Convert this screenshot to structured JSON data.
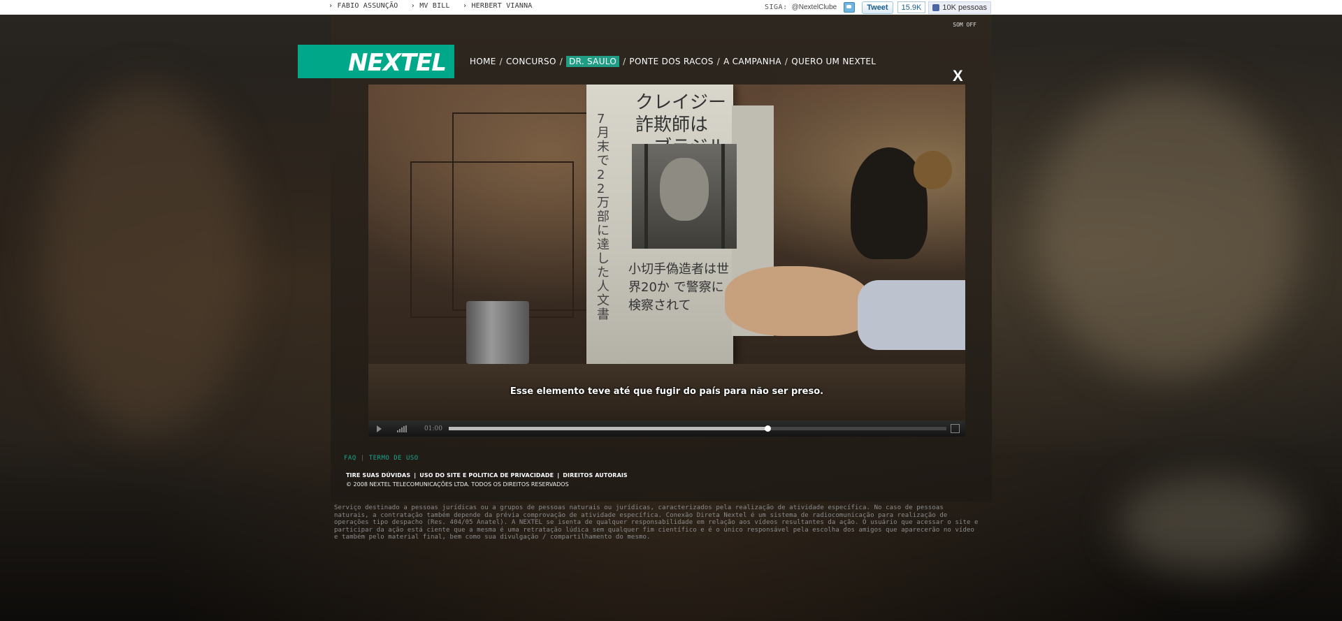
{
  "top_links": [
    "› FABIO ASSUNÇÃO",
    "› MV BILL",
    "› HERBERT VIANNA"
  ],
  "social": {
    "siga_label": "SIGA:",
    "twitter_handle": "@NextelClube",
    "tweet_label": "Tweet",
    "tweet_count": "15.9K",
    "like_label": "10K pessoas"
  },
  "sound_toggle": "SOM OFF",
  "logo_text": "NEXTEL",
  "nav": {
    "items": [
      "HOME",
      "CONCURSO",
      "DR. SAULO",
      "PONTE DOS RACOS",
      "A CAMPANHA",
      "QUERO UM NEXTEL"
    ],
    "active": "DR. SAULO",
    "separator": "/"
  },
  "close_label": "X",
  "video": {
    "subtitle": "Esse elemento teve até que fugir do país para não ser preso.",
    "headline_line1": "クレイジー詐欺師は",
    "headline_line2": "、ブラジル人です。",
    "vertical_text": "7月末で22万部に達した人文書",
    "bottom_text": "小切手偽造者は世界20か で警察に検察されて",
    "time": "01:00",
    "progress": 0.64
  },
  "footer": {
    "faq": "FAQ",
    "terms": "TERMO DE USO",
    "links": [
      "TIRE SUAS DÚVIDAS",
      "USO DO SITE E POLITICA DE PRIVACIDADE",
      "DIREITOS AUTORAIS"
    ],
    "copyright": "© 2008 NEXTEL TELECOMUNICAÇÕES LTDA. TODOS OS DIREITOS RESERVADOS",
    "disclaimer": "Serviço destinado a pessoas jurídicas ou a grupos de pessoas naturais ou jurídicas, caracterizados pela realização de atividade específica. No caso de pessoas naturais, a contratação também depende da prévia comprovação de atividade específica. Conexão Direta Nextel é um sistema de radiocomunicação para realização de operações tipo despacho (Res. 404/05 Anatel). A NEXTEL se isenta de qualquer responsabilidade em relação aos vídeos resultantes da ação. O usuário que acessar o site e participar da ação está ciente que a mesma é uma retratação lúdica sem qualquer fim científico e é o único responsável pela escolha dos amigos que aparecerão no vídeo e também pelo material final, bem como sua divulgação / compartilhamento do mesmo."
  },
  "colors": {
    "brand": "#00a88a",
    "active_nav": "#1f9d85",
    "faq": "#1aa58c"
  }
}
